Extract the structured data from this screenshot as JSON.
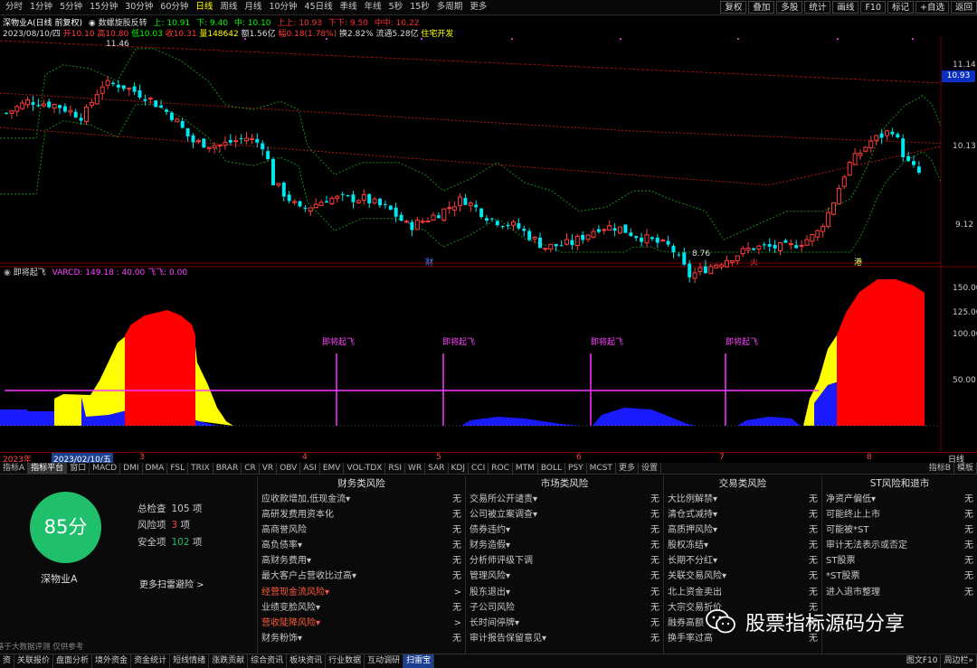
{
  "top_tabs": [
    "分时",
    "1分钟",
    "5分钟",
    "15分钟",
    "30分钟",
    "60分钟",
    "日线",
    "周线",
    "月线",
    "10分钟",
    "45日线",
    "季线",
    "年线",
    "5秒",
    "15秒",
    "多周期",
    "更多"
  ],
  "active_tab": "日线",
  "top_right_buttons": [
    "复权",
    "叠加",
    "多股",
    "统计",
    "画线",
    "F10",
    "标记",
    "+自选",
    "返回"
  ],
  "info_line1": {
    "stock": "深物业A(日线 前复权)",
    "indicator": "◉ 数螺旋股反转",
    "up": "上: 10.91",
    "down": "下: 9.40",
    "mid": "中: 10.10",
    "upup": "上上: 10.93",
    "downdown": "下下: 9.50",
    "midmid": "中中: 10.22"
  },
  "info_line2": {
    "date": "2023/08/10/四",
    "open": "开10.10",
    "high": "高10.80",
    "low": "低10.03",
    "close": "收10.31",
    "volume": "量148642",
    "amount": "额1.56亿",
    "change": "幅0.18(1.78%)",
    "turnover": "换2.82%",
    "float": "流通5.28亿",
    "tag": "住宅开发"
  },
  "y_labels": [
    "11.14",
    "10.13",
    "9.12"
  ],
  "price_box": "10.93",
  "high_mark": "11.46",
  "low_mark": "8.76",
  "markers": {
    "m1": "财",
    "m2": "火",
    "m3": "港"
  },
  "indicator_title": "即将起飞",
  "indicator_params": "VARCD: 149.18 : 40.00 飞飞: 0.00",
  "ind_y_labels": [
    "150.00",
    "125.00",
    "100.00",
    "50.00"
  ],
  "signal_label": "即将起飞",
  "time_axis": {
    "year": "2023年",
    "date": "2023/02/10/五",
    "m3": "3",
    "m4": "4",
    "m5": "5",
    "m6": "6",
    "m7": "7",
    "m8": "8",
    "right": "日线"
  },
  "indicator_tabs": [
    "指标A",
    "指标平台",
    "窗口",
    "MACD",
    "DMI",
    "DMA",
    "FSL",
    "TRIX",
    "BRAR",
    "CR",
    "VR",
    "OBV",
    "ASI",
    "EMV",
    "VOL-TDX",
    "RSI",
    "WR",
    "SAR",
    "KDJ",
    "CCI",
    "ROC",
    "MTM",
    "BOLL",
    "PSY",
    "MCST",
    "更多",
    "设置"
  ],
  "indicator_tabs_right": [
    "指标B",
    "模板"
  ],
  "active_indicator_tab": "指标平台",
  "score": "85分",
  "stock_name": "深物业A",
  "summary": [
    {
      "label": "总检查",
      "value": "105",
      "unit": "项",
      "color": "#c8c8c8"
    },
    {
      "label": "风险项",
      "value": "3",
      "unit": "项",
      "color": "#ff4040"
    },
    {
      "label": "安全项",
      "value": "102",
      "unit": "项",
      "color": "#1fbf6b"
    }
  ],
  "more_scan": "更多扫雷避险 >",
  "disclaimer": "基于大数据评测 仅供参考",
  "risk_columns": [
    {
      "title": "财务类风险",
      "rows": [
        {
          "l": "应收款增加,低现金流▾",
          "v": "无"
        },
        {
          "l": "高研发费用资本化",
          "v": "无"
        },
        {
          "l": "高商誉风险",
          "v": "无"
        },
        {
          "l": "高负债率▾",
          "v": "无"
        },
        {
          "l": "高财务费用▾",
          "v": "无"
        },
        {
          "l": "最大客户占营收比过高▾",
          "v": "无"
        },
        {
          "l": "经营现金流风险▾",
          "v": ">",
          "red": true
        },
        {
          "l": "业绩变脸风险▾",
          "v": "无"
        },
        {
          "l": "营收陡降风险▾",
          "v": ">",
          "red": true
        },
        {
          "l": "财务粉饰▾",
          "v": "无"
        }
      ]
    },
    {
      "title": "市场类风险",
      "rows": [
        {
          "l": "交易所公开谴责▾",
          "v": "无"
        },
        {
          "l": "公司被立案调查▾",
          "v": "无"
        },
        {
          "l": "债券违约▾",
          "v": "无"
        },
        {
          "l": "财务造假▾",
          "v": "无"
        },
        {
          "l": "分析师评级下调",
          "v": "无"
        },
        {
          "l": "管理风险▾",
          "v": "无"
        },
        {
          "l": "股东退出▾",
          "v": "无"
        },
        {
          "l": "子公司风险",
          "v": "无"
        },
        {
          "l": "长时间停牌▾",
          "v": "无"
        },
        {
          "l": "审计报告保留意见▾",
          "v": "无"
        }
      ]
    },
    {
      "title": "交易类风险",
      "rows": [
        {
          "l": "大比例解禁▾",
          "v": "无"
        },
        {
          "l": "清仓式减持▾",
          "v": "无"
        },
        {
          "l": "高质押风险▾",
          "v": "无"
        },
        {
          "l": "股权冻结▾",
          "v": "无"
        },
        {
          "l": "长期不分红▾",
          "v": "无"
        },
        {
          "l": "关联交易风险▾",
          "v": "无"
        },
        {
          "l": "北上资金卖出",
          "v": "无"
        },
        {
          "l": "大宗交易折价",
          "v": "无"
        },
        {
          "l": "融券高额",
          "v": "无"
        },
        {
          "l": "换手率过高",
          "v": "无"
        }
      ]
    },
    {
      "title": "ST风险和退市",
      "rows": [
        {
          "l": "净资产偏低▾",
          "v": "无"
        },
        {
          "l": "可能终止上市",
          "v": "无"
        },
        {
          "l": "可能被*ST",
          "v": "无"
        },
        {
          "l": "审计无法表示或否定",
          "v": "无"
        },
        {
          "l": "ST股票",
          "v": "无"
        },
        {
          "l": "*ST股票",
          "v": "无"
        },
        {
          "l": "进入退市整理",
          "v": "无"
        },
        {
          "l": "",
          "v": ""
        },
        {
          "l": "",
          "v": ""
        },
        {
          "l": "",
          "v": ""
        }
      ]
    }
  ],
  "status_bar": [
    "资",
    "关联报价",
    "盘面分析",
    "境外资金",
    "资金统计",
    "短线情绪",
    "涨跌贡献",
    "综合资讯",
    "板块资讯",
    "行业数据",
    "互动调研",
    "扫雷宝"
  ],
  "status_bar_active": "扫雷宝",
  "status_right": "图文F10",
  "status_right2": "周边栏»",
  "watermark": "股票指标源码分享",
  "colors": {
    "up": "#ff3c3c",
    "down": "#00e5ee",
    "red_area": "#ff0000",
    "yellow_area": "#ffff00",
    "blue_area": "#1a1aff",
    "signal": "#ff33ff",
    "accent": "#ffff00",
    "safe": "#1fbf6b"
  }
}
